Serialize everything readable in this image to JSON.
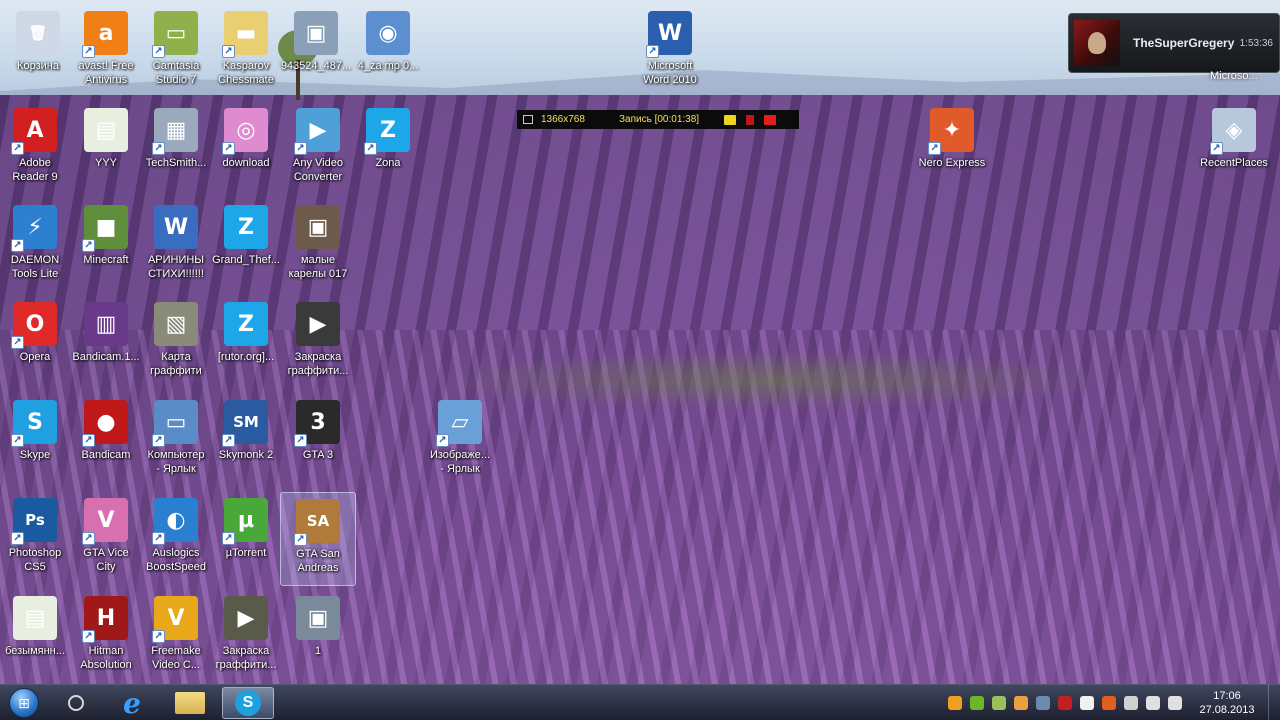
{
  "desktop": {
    "icons": [
      {
        "id": "recycle-bin",
        "label": "Корзина",
        "icon": "recycle-bin-icon",
        "color": "#cfd8e6",
        "glyph": "🗑",
        "shortcut": false
      },
      {
        "id": "avast",
        "label": "avast! Free\nAntivirus",
        "icon": "avast-icon",
        "color": "#f07f17",
        "glyph": "a",
        "shortcut": true
      },
      {
        "id": "camtasia",
        "label": "Camtasia\nStudio 7",
        "icon": "camtasia-icon",
        "color": "#8fb04a",
        "glyph": "▭",
        "shortcut": true
      },
      {
        "id": "kasparov",
        "label": "Kasparov\nChessmate",
        "icon": "folder-icon",
        "color": "#e9cf72",
        "glyph": "▬",
        "shortcut": true
      },
      {
        "id": "photo943",
        "label": "943524_487...",
        "icon": "image-icon",
        "color": "#8aa0b8",
        "glyph": "▣",
        "shortcut": false
      },
      {
        "id": "shield4",
        "label": "4_za mp 0...",
        "icon": "shield-icon",
        "color": "#5b8fcf",
        "glyph": "◉",
        "shortcut": false
      },
      {
        "id": "word2010",
        "label": "Microsoft\nWord 2010",
        "icon": "word-icon",
        "color": "#2a5fb0",
        "glyph": "W",
        "shortcut": true
      },
      {
        "id": "adobe-reader",
        "label": "Adobe\nReader 9",
        "icon": "adobe-reader-icon",
        "color": "#d21f1f",
        "glyph": "A",
        "shortcut": true
      },
      {
        "id": "yyy",
        "label": "YYY",
        "icon": "document-icon",
        "color": "#e8efe0",
        "glyph": "▤",
        "shortcut": false
      },
      {
        "id": "techsmith",
        "label": "TechSmith...",
        "icon": "computer-icon",
        "color": "#9aa9bb",
        "glyph": "▦",
        "shortcut": true
      },
      {
        "id": "download",
        "label": "download",
        "icon": "disc-icon",
        "color": "#e08ad0",
        "glyph": "◎",
        "shortcut": true
      },
      {
        "id": "any-video",
        "label": "Any Video\nConverter",
        "icon": "video-converter-icon",
        "color": "#4fa0d8",
        "glyph": "▶",
        "shortcut": true
      },
      {
        "id": "zona",
        "label": "Zona",
        "icon": "zona-icon",
        "color": "#1ea7e8",
        "glyph": "Z",
        "shortcut": true
      },
      {
        "id": "nero",
        "label": "Nero Express",
        "icon": "nero-icon",
        "color": "#e05a2a",
        "glyph": "✦",
        "shortcut": true
      },
      {
        "id": "recent-places",
        "label": "RecentPlaces",
        "icon": "recent-places-icon",
        "color": "#b8c8dc",
        "glyph": "◈",
        "shortcut": true
      },
      {
        "id": "daemon",
        "label": "DAEMON\nTools Lite",
        "icon": "daemon-tools-icon",
        "color": "#2d7fd0",
        "glyph": "⚡",
        "shortcut": true
      },
      {
        "id": "minecraft",
        "label": "Minecraft",
        "icon": "minecraft-icon",
        "color": "#5f8f3a",
        "glyph": "■",
        "shortcut": true
      },
      {
        "id": "arinini",
        "label": "АРИНИНЫ\nСТИХИ!!!!!!",
        "icon": "word-document-icon",
        "color": "#3a6cc0",
        "glyph": "W",
        "shortcut": false
      },
      {
        "id": "grand-theft",
        "label": "Grand_Thef...",
        "icon": "torrent-icon",
        "color": "#1ea7e8",
        "glyph": "Z",
        "shortcut": false
      },
      {
        "id": "malye",
        "label": "малые\nкарелы 017",
        "icon": "photo-icon",
        "color": "#6c5a4a",
        "glyph": "▣",
        "shortcut": false
      },
      {
        "id": "opera",
        "label": "Opera",
        "icon": "opera-icon",
        "color": "#e02a2a",
        "glyph": "O",
        "shortcut": true
      },
      {
        "id": "bandicam1",
        "label": "Bandicam.1...",
        "icon": "archive-icon",
        "color": "#6a3a8a",
        "glyph": "▥",
        "shortcut": false
      },
      {
        "id": "karta",
        "label": "Карта\nграффити",
        "icon": "map-image-icon",
        "color": "#8a8a7a",
        "glyph": "▧",
        "shortcut": false
      },
      {
        "id": "rutor",
        "label": "[rutor.org]...",
        "icon": "torrent-icon",
        "color": "#1ea7e8",
        "glyph": "Z",
        "shortcut": false
      },
      {
        "id": "zakraska1",
        "label": "Закраска\nграффити...",
        "icon": "video-file-icon",
        "color": "#3a3a3a",
        "glyph": "▶",
        "shortcut": false
      },
      {
        "id": "skype",
        "label": "Skype",
        "icon": "skype-icon",
        "color": "#1fa0e0",
        "glyph": "S",
        "shortcut": true
      },
      {
        "id": "bandicam",
        "label": "Bandicam",
        "icon": "bandicam-icon",
        "color": "#c01818",
        "glyph": "●",
        "shortcut": true
      },
      {
        "id": "computer",
        "label": "Компьютер\n- Ярлык",
        "icon": "computer-icon",
        "color": "#5a8cc8",
        "glyph": "▭",
        "shortcut": true
      },
      {
        "id": "skymonk",
        "label": "Skymonk 2",
        "icon": "skymonk-icon",
        "color": "#2a5aa0",
        "glyph": "SM",
        "shortcut": true
      },
      {
        "id": "gta3",
        "label": "GTA 3",
        "icon": "gta3-icon",
        "color": "#2a2a2a",
        "glyph": "3",
        "shortcut": true
      },
      {
        "id": "izobrazhe",
        "label": "Изображе...\n- Ярлык",
        "icon": "image-viewer-icon",
        "color": "#6aa0d8",
        "glyph": "▱",
        "shortcut": true
      },
      {
        "id": "photoshop",
        "label": "Photoshop\nCS5",
        "icon": "photoshop-icon",
        "color": "#1a5aa0",
        "glyph": "Ps",
        "shortcut": true
      },
      {
        "id": "gta-vice",
        "label": "GTA Vice\nCity",
        "icon": "gta-vice-city-icon",
        "color": "#d870b0",
        "glyph": "V",
        "shortcut": true
      },
      {
        "id": "auslogics",
        "label": "Auslogics\nBoostSpeed",
        "icon": "globe-icon",
        "color": "#2a7fd0",
        "glyph": "◐",
        "shortcut": true
      },
      {
        "id": "utorrent",
        "label": "µTorrent",
        "icon": "utorrent-icon",
        "color": "#4aa83a",
        "glyph": "µ",
        "shortcut": true
      },
      {
        "id": "gta-sa",
        "label": "GTA San\nAndreas",
        "icon": "gta-san-andreas-icon",
        "color": "#b07a3a",
        "glyph": "SA",
        "shortcut": true
      },
      {
        "id": "bezymyann",
        "label": "безымянн...",
        "icon": "document-icon",
        "color": "#e8efe0",
        "glyph": "▤",
        "shortcut": false
      },
      {
        "id": "hitman",
        "label": "Hitman\nAbsolution",
        "icon": "hitman-icon",
        "color": "#a01818",
        "glyph": "H",
        "shortcut": true
      },
      {
        "id": "freemake",
        "label": "Freemake\nVideo C...",
        "icon": "freemake-icon",
        "color": "#e8a81a",
        "glyph": "V",
        "shortcut": true
      },
      {
        "id": "zakraska2",
        "label": "Закраска\nграффити...",
        "icon": "video-file-icon",
        "color": "#5a5a4a",
        "glyph": "▶",
        "shortcut": false
      },
      {
        "id": "one",
        "label": "1",
        "icon": "photo-icon",
        "color": "#7a8a9a",
        "glyph": "▣",
        "shortcut": false
      }
    ],
    "selected": "gta-sa"
  },
  "recording_bar": {
    "resolution": "1366x768",
    "status": "Запись [00:01:38]",
    "colors": {
      "text": "#f0e060",
      "record": "#e02020",
      "camera": "#f0d020"
    }
  },
  "notification": {
    "name": "TheSuperGregery",
    "time": "1:53:36",
    "partial_label": "Microso..."
  },
  "taskbar": {
    "buttons": [
      {
        "id": "start",
        "icon": "windows-start-icon"
      },
      {
        "id": "circle-app",
        "icon": "circle-app-icon"
      },
      {
        "id": "ie",
        "icon": "internet-explorer-icon",
        "glyph": "e"
      },
      {
        "id": "explorer",
        "icon": "folder-icon"
      },
      {
        "id": "skype-task",
        "icon": "skype-icon",
        "glyph": "S",
        "active": true
      }
    ],
    "tray_icons": [
      {
        "icon": "avast-tray-icon",
        "color": "#f0a020"
      },
      {
        "icon": "nvidia-tray-icon",
        "color": "#6ab82a"
      },
      {
        "icon": "tray-app-icon",
        "color": "#9ac05a"
      },
      {
        "icon": "tray-app-icon",
        "color": "#e8a040"
      },
      {
        "icon": "tray-app-icon",
        "color": "#6a8ab0"
      },
      {
        "icon": "bandicam-tray-icon",
        "color": "#c02020"
      },
      {
        "icon": "flag-icon",
        "color": "#f0f0f0"
      },
      {
        "icon": "tray-app-icon",
        "color": "#e06020"
      },
      {
        "icon": "tray-app-icon",
        "color": "#d0d0d0"
      },
      {
        "icon": "network-icon",
        "color": "#e0e0e0"
      },
      {
        "icon": "volume-icon",
        "color": "#e0e0e0"
      }
    ],
    "clock": {
      "time": "17:06",
      "date": "27.08.2013"
    }
  }
}
